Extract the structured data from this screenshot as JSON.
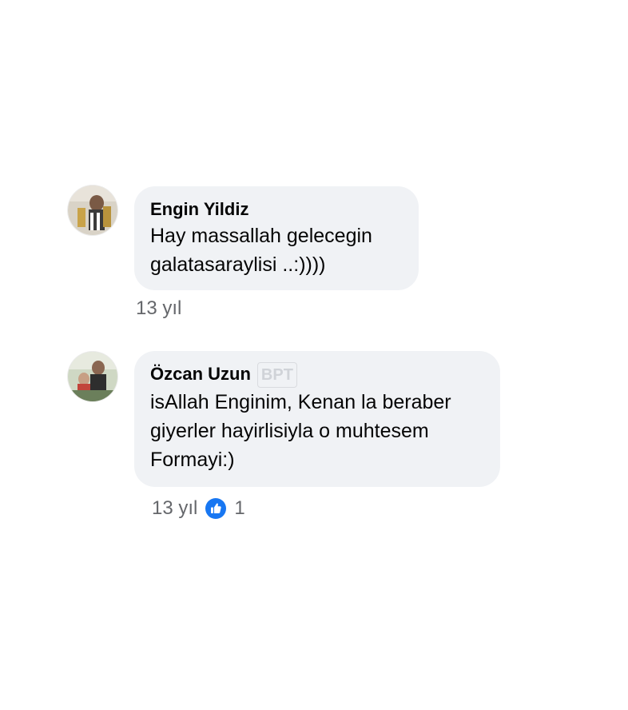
{
  "comments": [
    {
      "author": "Engin Yildiz",
      "text": "Hay massallah gelecegin\ngalatasaraylisi ..:))))",
      "time": "13 yıl"
    },
    {
      "author": "Özcan Uzun",
      "text": "isAllah Enginim, Kenan la beraber\ngiyerler hayirlisiyla o muhtesem\nFormayi:)",
      "time": "13 yıl",
      "likes": "1"
    }
  ],
  "colors": {
    "bubble": "#f0f2f5",
    "meta_text": "#65676b",
    "like_blue": "#1877f2"
  },
  "icons": {
    "like": "thumbs-up-icon"
  }
}
